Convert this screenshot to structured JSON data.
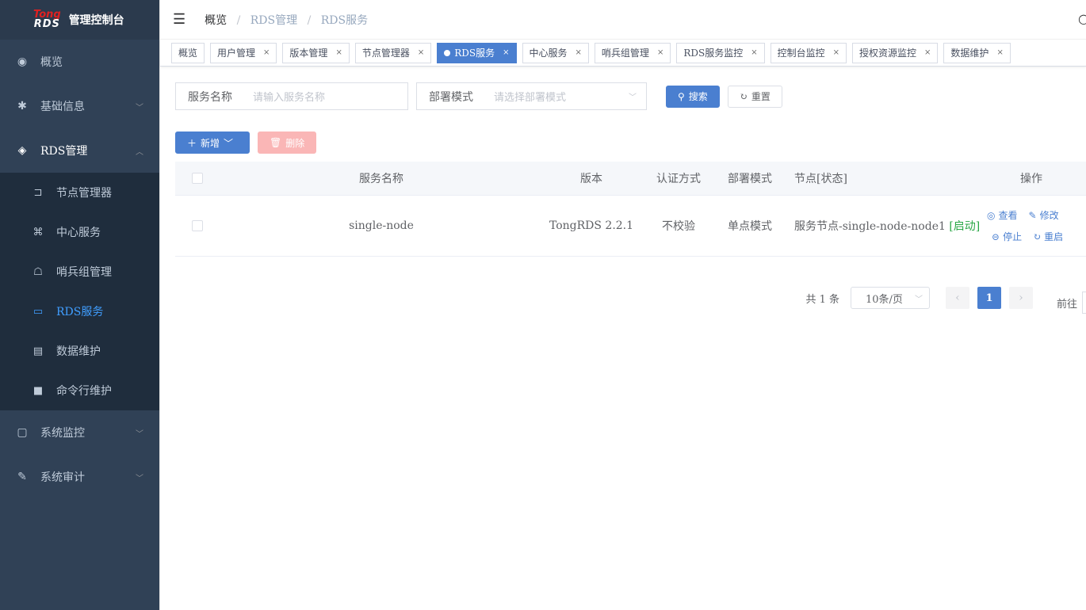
{
  "logo": {
    "top": "Tong",
    "bottom": "RDS",
    "title": "管理控制台"
  },
  "sidebar": {
    "items": [
      {
        "label": "概览",
        "icon": "dashboard-icon"
      },
      {
        "label": "基础信息",
        "icon": "gear-icon",
        "arrow": "chevron-down"
      },
      {
        "label": "RDS管理",
        "icon": "layers-icon",
        "arrow": "chevron-up",
        "open": true
      },
      {
        "label": "系统监控",
        "icon": "monitor-icon",
        "arrow": "chevron-down"
      },
      {
        "label": "系统审计",
        "icon": "edit-icon",
        "arrow": "chevron-down"
      }
    ],
    "subitems": [
      {
        "label": "节点管理器",
        "icon": "plugin-icon"
      },
      {
        "label": "中心服务",
        "icon": "center-icon"
      },
      {
        "label": "哨兵组管理",
        "icon": "sentinel-icon"
      },
      {
        "label": "RDS服务",
        "icon": "screen-icon",
        "active": true
      },
      {
        "label": "数据维护",
        "icon": "keyboard-icon"
      },
      {
        "label": "命令行维护",
        "icon": "terminal-icon"
      }
    ]
  },
  "breadcrumb": {
    "home": "概览",
    "level2": "RDS管理",
    "current": "RDS服务"
  },
  "tags": [
    {
      "label": "概览",
      "closable": false
    },
    {
      "label": "用户管理",
      "closable": true
    },
    {
      "label": "版本管理",
      "closable": true
    },
    {
      "label": "节点管理器",
      "closable": true
    },
    {
      "label": "RDS服务",
      "closable": true,
      "active": true
    },
    {
      "label": "中心服务",
      "closable": true
    },
    {
      "label": "哨兵组管理",
      "closable": true
    },
    {
      "label": "RDS服务监控",
      "closable": true
    },
    {
      "label": "控制台监控",
      "closable": true
    },
    {
      "label": "授权资源监控",
      "closable": true
    },
    {
      "label": "数据维护",
      "closable": true
    }
  ],
  "search": {
    "name_label": "服务名称",
    "name_placeholder": "请输入服务名称",
    "mode_label": "部署模式",
    "mode_placeholder": "请选择部署模式",
    "search_btn": "搜索",
    "reset_btn": "重置"
  },
  "toolbar": {
    "add_btn": "新增",
    "delete_btn": "删除"
  },
  "table": {
    "headers": {
      "name": "服务名称",
      "version": "版本",
      "auth": "认证方式",
      "mode": "部署模式",
      "node": "节点[状态]",
      "ops": "操作"
    },
    "rows": [
      {
        "name": "single-node",
        "version": "TongRDS 2.2.1",
        "auth": "不校验",
        "mode": "单点模式",
        "node": "服务节点-single-node-node1",
        "status": "[启动]",
        "ops": {
          "view": "查看",
          "edit": "修改",
          "stop": "停止",
          "restart": "重启"
        }
      }
    ]
  },
  "pager": {
    "total": "共 1 条",
    "size": "10条/页",
    "current": "1",
    "goto": "前往"
  },
  "colors": {
    "sidebar": "#304156",
    "accent": "#4a7fd0",
    "status": "#28a745",
    "danger_disabled": "#fab6b6"
  }
}
